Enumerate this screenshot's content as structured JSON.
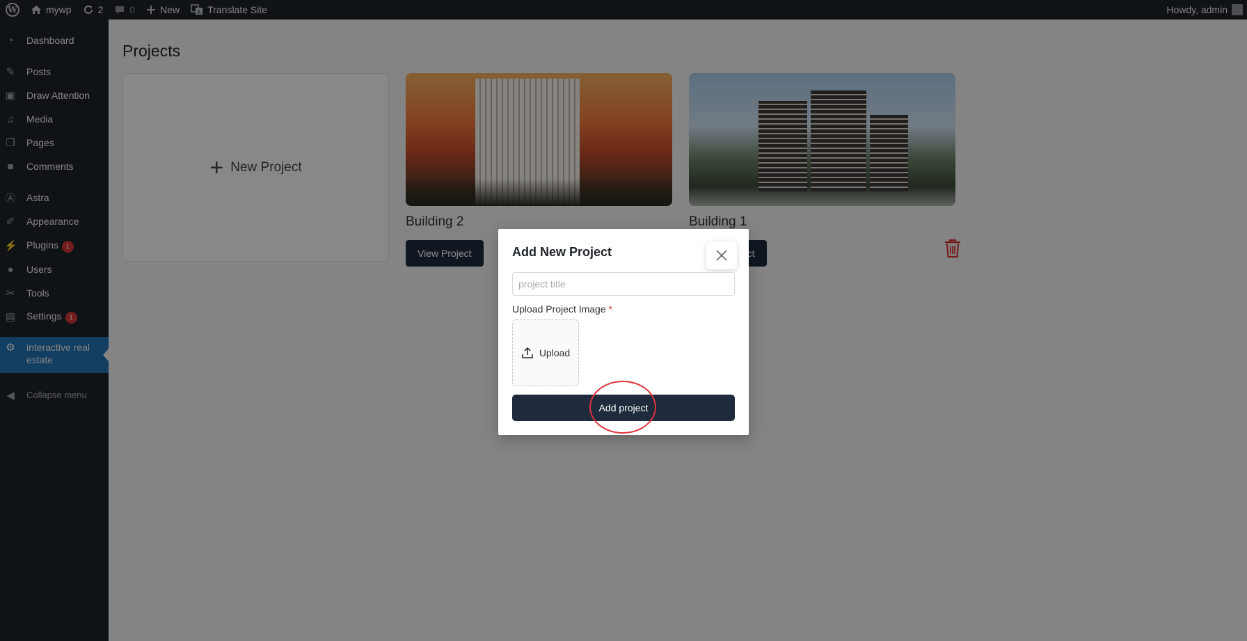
{
  "adminbar": {
    "site_name": "mywp",
    "updates_count": "2",
    "comments_count": "0",
    "new_label": "New",
    "translate_label": "Translate Site",
    "howdy": "Howdy, admin"
  },
  "sidebar": {
    "items": [
      {
        "label": "Dashboard",
        "icon": "dashboard-icon"
      },
      {
        "label": "Posts",
        "icon": "pin-icon"
      },
      {
        "label": "Draw Attention",
        "icon": "image-map-icon"
      },
      {
        "label": "Media",
        "icon": "media-icon"
      },
      {
        "label": "Pages",
        "icon": "pages-icon"
      },
      {
        "label": "Comments",
        "icon": "comment-icon"
      },
      {
        "label": "Astra",
        "icon": "astra-icon"
      },
      {
        "label": "Appearance",
        "icon": "brush-icon"
      },
      {
        "label": "Plugins",
        "icon": "plug-icon",
        "badge": "1"
      },
      {
        "label": "Users",
        "icon": "user-icon"
      },
      {
        "label": "Tools",
        "icon": "wrench-icon"
      },
      {
        "label": "Settings",
        "icon": "settings-icon",
        "badge": "1"
      },
      {
        "label": "interactive real estate",
        "icon": "gear-icon",
        "active": true
      }
    ],
    "collapse_label": "Collapse menu"
  },
  "main": {
    "page_title": "Projects",
    "new_project_label": "New Project",
    "projects": [
      {
        "name": "Building 2",
        "button": "View Project"
      },
      {
        "name": "Building 1",
        "button": "View Project"
      }
    ]
  },
  "modal": {
    "title": "Add New Project",
    "title_placeholder": "project title",
    "title_value": "",
    "upload_label": "Upload Project Image",
    "required_mark": "*",
    "upload_button": "Upload",
    "submit_button": "Add project"
  },
  "colors": {
    "adminbar_bg": "#1d2327",
    "active_menu": "#2271b1",
    "primary_button": "#1f2b3c",
    "danger": "#d63638"
  }
}
